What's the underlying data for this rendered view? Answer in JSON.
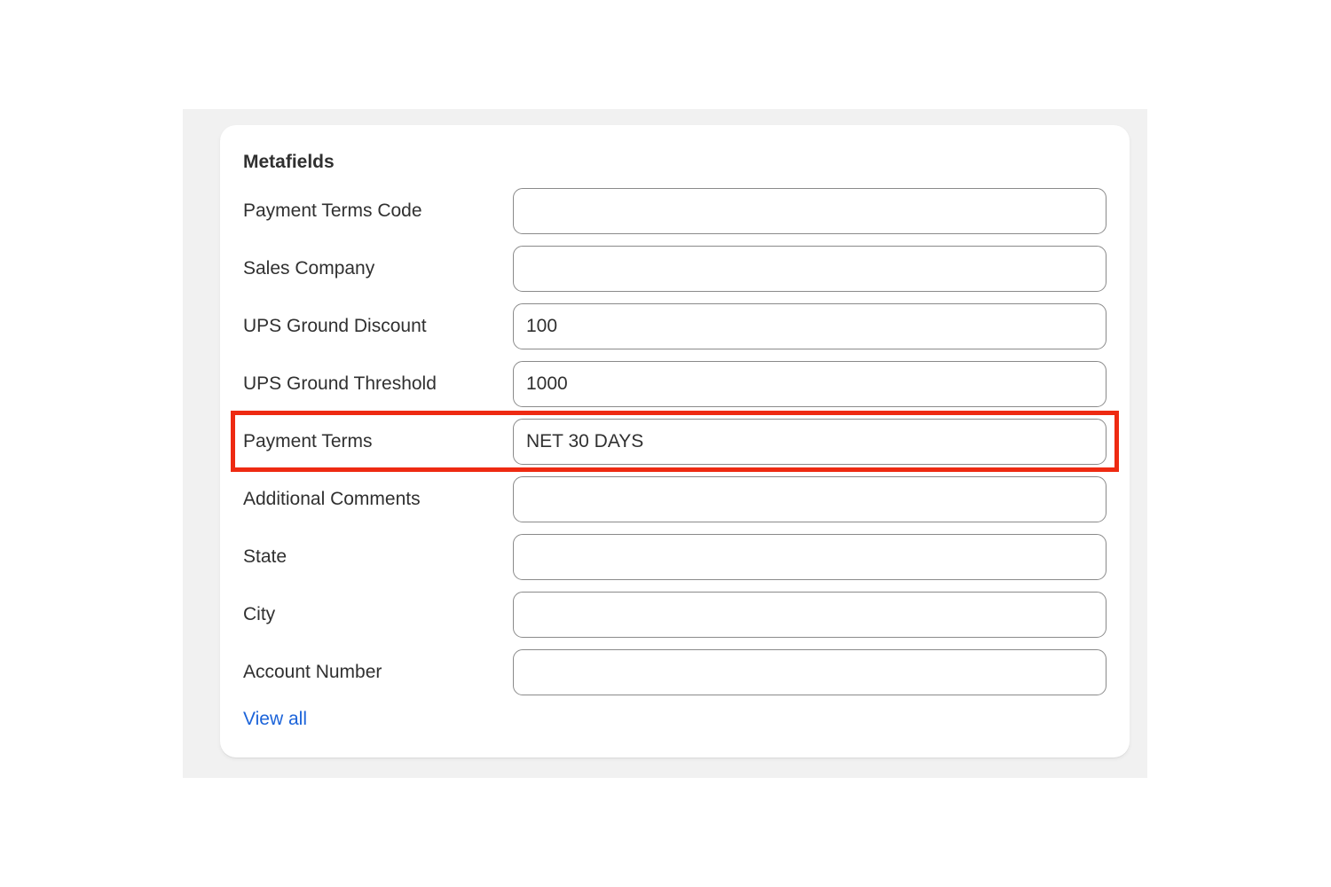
{
  "card": {
    "title": "Metafields",
    "fields": [
      {
        "label": "Payment Terms Code",
        "value": ""
      },
      {
        "label": "Sales Company",
        "value": ""
      },
      {
        "label": "UPS Ground Discount",
        "value": "100"
      },
      {
        "label": "UPS Ground Threshold",
        "value": "1000"
      },
      {
        "label": "Payment Terms",
        "value": "NET 30 DAYS"
      },
      {
        "label": "Additional Comments",
        "value": ""
      },
      {
        "label": "State",
        "value": ""
      },
      {
        "label": "City",
        "value": ""
      },
      {
        "label": "Account Number",
        "value": ""
      }
    ],
    "view_all_label": "View all"
  },
  "colors": {
    "highlight": "#ee2a12",
    "link": "#1b63d9"
  }
}
